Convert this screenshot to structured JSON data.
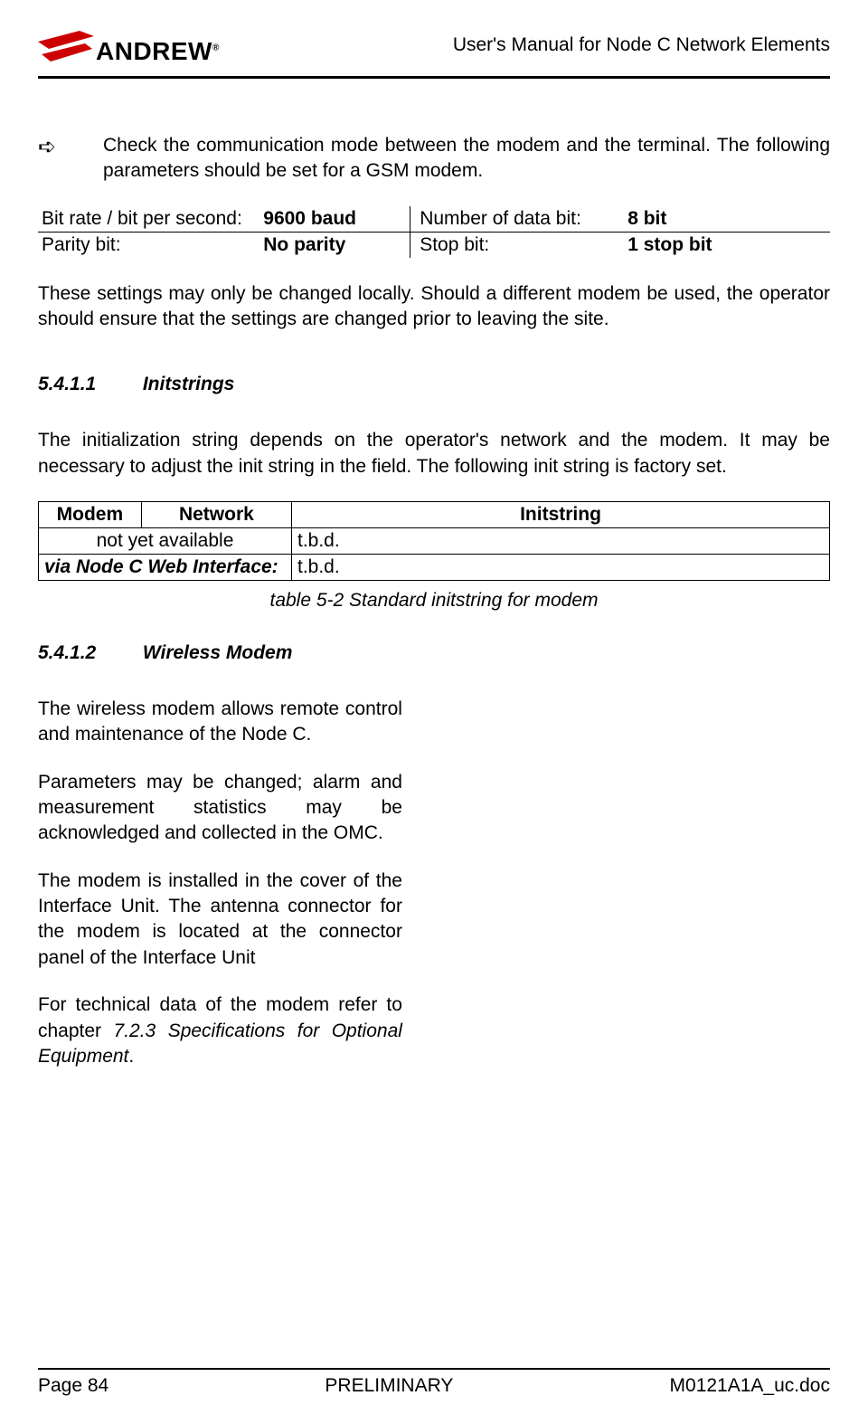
{
  "header": {
    "logo_text": "ANDREW",
    "title": "User's Manual for Node C Network Elements"
  },
  "bullet": {
    "symbol": "➪",
    "text": "Check the communication mode between the modem and the terminal. The following parameters should be set for a GSM modem."
  },
  "params": {
    "r1c1": "Bit rate / bit per second:",
    "r1c2": "9600 baud",
    "r1c3": "Number of data bit:",
    "r1c4": "8 bit",
    "r2c1": "Parity bit:",
    "r2c2": "No parity",
    "r2c3": "Stop bit:",
    "r2c4": "1 stop bit"
  },
  "para1": "These settings may only be changed locally. Should a different modem be used, the operator should ensure that the settings are changed prior to leaving the site.",
  "sec1": {
    "num": "5.4.1.1",
    "title": "Initstrings"
  },
  "para2": "The initialization string depends on the operator's network and the modem. It may be necessary to adjust the init string in the field. The following init string is factory set.",
  "init_table": {
    "h1": "Modem",
    "h2": "Network",
    "h3": "Initstring",
    "r1c1": "not yet available",
    "r1c2": "t.b.d.",
    "r2c1": "via Node C Web Interface:",
    "r2c2": "t.b.d."
  },
  "caption": "table 5-2 Standard initstring for modem",
  "sec2": {
    "num": "5.4.1.2",
    "title": "Wireless Modem"
  },
  "wm_p1": "The wireless modem allows remote control and maintenance of the Node C.",
  "wm_p2": "Parameters may be changed; alarm and measurement statistics may be acknowledged and collected in the OMC.",
  "wm_p3": "The modem is installed in the cover of the Interface Unit. The antenna connector for the modem is located at the connector panel of the Interface Unit",
  "wm_p4_pre": "For technical data of the modem refer to chapter ",
  "wm_p4_ref": "7.2.3 Specifications for Optional Equipment",
  "wm_p4_post": ".",
  "footer": {
    "left": "Page 84",
    "center": "PRELIMINARY",
    "right": "M0121A1A_uc.doc"
  }
}
